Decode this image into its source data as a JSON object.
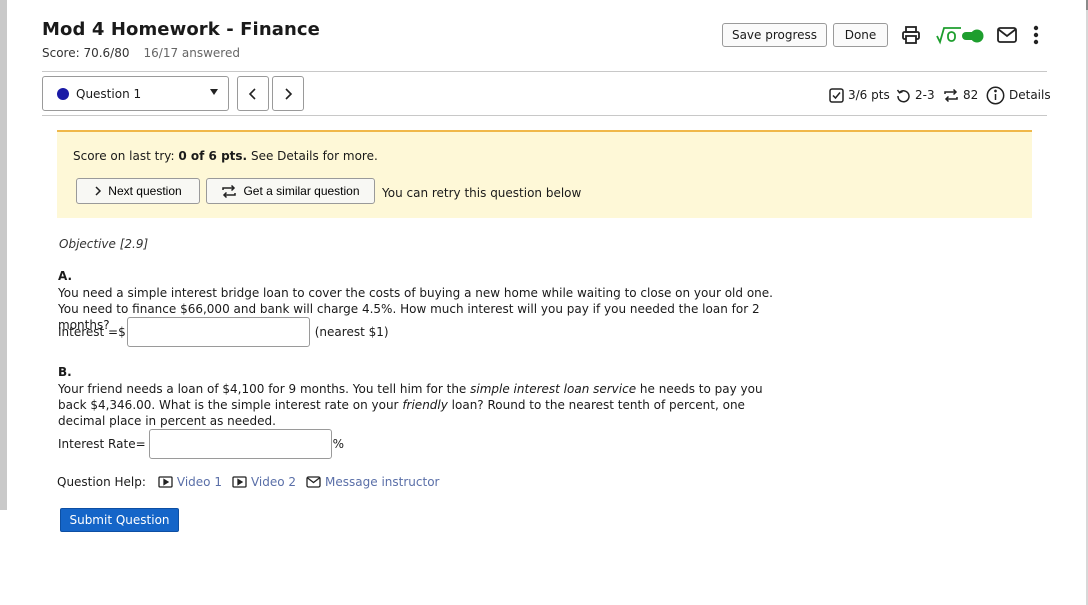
{
  "header": {
    "title": "Mod 4 Homework - Finance",
    "score": "Score: 70.6/80",
    "answered": "16/17 answered",
    "save_label": "Save progress",
    "done_label": "Done",
    "icons": [
      "print-icon",
      "sqrt-icon",
      "toggle-icon",
      "mail-icon",
      "kebab-icon"
    ],
    "toggle_color": "#1e9e2e"
  },
  "question_nav": {
    "selected": "Question 1",
    "dot_color": "#1a1aa6",
    "prev_icon": "chevron-left-icon",
    "next_icon": "chevron-right-icon"
  },
  "meta": {
    "points": "3/6 pts",
    "tries": "2-3",
    "similar": "82",
    "details": "Details"
  },
  "banner": {
    "prefix": "Score on last try:",
    "score": "0 of 6 pts.",
    "suffix": "See Details for more.",
    "next_label": "Next question",
    "similar_label": "Get a similar question",
    "retry_note": "You can retry this question below",
    "bg_color": "#fef8d7",
    "accent_color": "#f0b84a"
  },
  "objective": "Objective [2.9]",
  "part_a": {
    "label": "A.",
    "text": "You need a simple interest bridge loan to cover the costs of buying a new home while waiting to close on your old one. You need to finance $66,000 and bank will charge 4.5%. How much interest will you pay if you needed the loan for 2 months?",
    "prompt": "Interest =$",
    "value": "",
    "suffix": "(nearest $1)"
  },
  "part_b": {
    "label": "B.",
    "text_1": "Your friend needs a loan of $4,100 for 9 months. You tell him for the ",
    "text_em1": "simple interest loan service",
    "text_2": " he needs to pay you back $4,346.00. What is the simple interest rate on your ",
    "text_em2": "friendly",
    "text_3": " loan? Round to the nearest tenth of percent, one decimal place in percent as needed.",
    "prompt": "Interest Rate=",
    "value": "",
    "suffix": "%"
  },
  "help": {
    "label": "Question Help:",
    "video1": "Video 1",
    "video2": "Video 2",
    "message": "Message instructor",
    "link_color": "#5a6fa8"
  },
  "submit_label": "Submit Question",
  "submit_color": "#1565c8"
}
